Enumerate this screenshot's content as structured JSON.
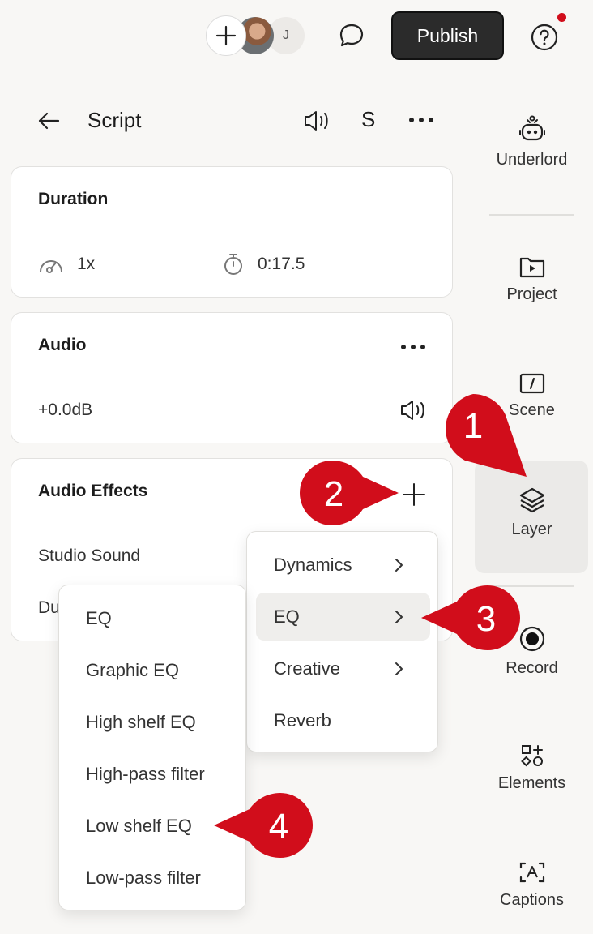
{
  "topbar": {
    "avatar_initial": "J",
    "publish_label": "Publish",
    "accent_dot_color": "#d10d1b"
  },
  "header": {
    "title": "Script",
    "voice_label": "S"
  },
  "duration_card": {
    "title": "Duration",
    "speed": "1x",
    "time": "0:17.5"
  },
  "audio_card": {
    "title": "Audio",
    "gain": "+0.0dB"
  },
  "effects_card": {
    "title": "Audio Effects",
    "items": [
      "Studio Sound",
      "Du"
    ]
  },
  "effects_menu": {
    "items": [
      {
        "label": "Dynamics",
        "submenu": true
      },
      {
        "label": "EQ",
        "submenu": true,
        "highlighted": true
      },
      {
        "label": "Creative",
        "submenu": true
      },
      {
        "label": "Reverb",
        "submenu": false
      }
    ]
  },
  "eq_submenu": {
    "items": [
      "EQ",
      "Graphic EQ",
      "High shelf EQ",
      "High-pass filter",
      "Low shelf EQ",
      "Low-pass filter"
    ]
  },
  "rail": {
    "items": [
      {
        "label": "Underlord",
        "icon": "robot-icon"
      },
      {
        "label": "Project",
        "icon": "folder-play-icon"
      },
      {
        "label": "Scene",
        "icon": "scene-slash-icon"
      },
      {
        "label": "Layer",
        "icon": "layers-icon",
        "active": true
      },
      {
        "label": "Record",
        "icon": "record-icon"
      },
      {
        "label": "Elements",
        "icon": "shapes-icon"
      },
      {
        "label": "Captions",
        "icon": "captions-icon"
      }
    ]
  },
  "callouts": {
    "color": "#d10d1b",
    "labels": [
      "1",
      "2",
      "3",
      "4"
    ]
  }
}
